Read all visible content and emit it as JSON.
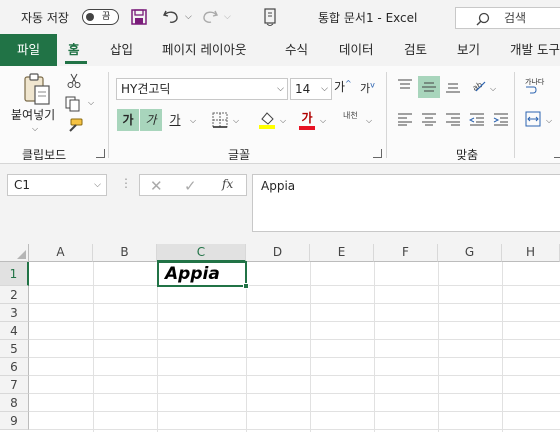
{
  "titlebar": {
    "autosave_label": "자동 저장",
    "autosave_state": "끔",
    "document_title": "통합 문서1  -  Excel",
    "search_placeholder": "검색"
  },
  "tabs": [
    "파일",
    "홈",
    "삽입",
    "페이지 레이아웃",
    "수식",
    "데이터",
    "검토",
    "보기",
    "개발 도구"
  ],
  "ribbon": {
    "clipboard": {
      "paste_label": "붙여넣기",
      "group_label": "클립보드"
    },
    "font": {
      "font_name": "HY견고딕",
      "font_size": "14",
      "grow_label": "가",
      "shrink_label": "가",
      "bold_label": "가",
      "italic_label": "가",
      "underline_label": "가",
      "font_color_label": "가",
      "phonetic_label": "내천",
      "group_label": "글꼴"
    },
    "alignment": {
      "group_label": "맞춤",
      "wrap_label": "가나다"
    }
  },
  "formula_bar": {
    "name_box": "C1",
    "fx_label": "fx",
    "formula": "Appia"
  },
  "sheet": {
    "columns": [
      "A",
      "B",
      "C",
      "D",
      "E",
      "F",
      "G",
      "H"
    ],
    "rows": [
      "1",
      "2",
      "3",
      "4",
      "5",
      "6",
      "7",
      "8",
      "9"
    ],
    "selected_column": "C",
    "selected_row": "1",
    "cells": {
      "C1": "Appia"
    }
  },
  "colors": {
    "accent": "#217346",
    "toggle_on_bg": "#a8d5bc",
    "font_color_bar": "#e81123",
    "highlight_bar": "#ffff00"
  }
}
